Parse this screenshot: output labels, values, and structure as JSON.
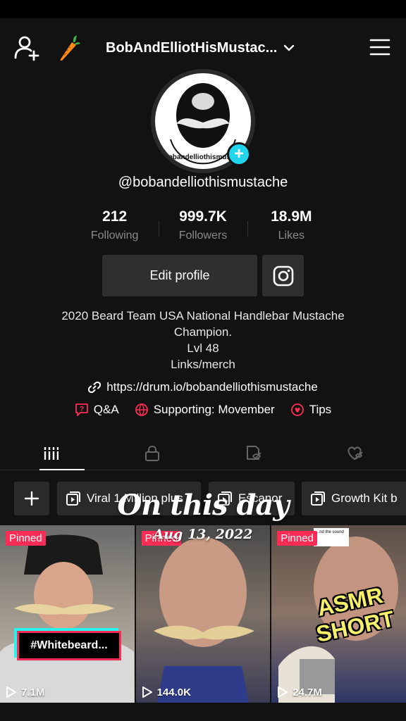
{
  "header": {
    "account_name": "BobAndElliotHisMustac...",
    "add_friend_icon": "user-plus-icon",
    "badge_icon": "carrot-icon",
    "menu_icon": "hamburger-icon"
  },
  "profile": {
    "avatar_text": "@bobandelliothismustache",
    "handle": "@bobandelliothismustache",
    "stats": [
      {
        "value": "212",
        "label": "Following"
      },
      {
        "value": "999.7K",
        "label": "Followers"
      },
      {
        "value": "18.9M",
        "label": "Likes"
      }
    ],
    "edit_label": "Edit profile",
    "bio_lines": [
      "2020 Beard Team USA National Handlebar Mustache",
      "Champion.",
      "Lvl 48",
      "Links/merch"
    ],
    "link": "https://drum.io/bobandelliothismustache",
    "chips": {
      "qa": "Q&A",
      "supporting": "Supporting: Movember",
      "tips": "Tips"
    }
  },
  "playlists": [
    "Viral 1 Million plus",
    "Escanor",
    "Growth Kit b"
  ],
  "overlay": {
    "title": "On this day",
    "date": "Aug 13, 2022"
  },
  "videos": [
    {
      "pinned": "Pinned",
      "views": "7.1M",
      "caption": "#Whitebeard..."
    },
    {
      "pinned": "Pinned",
      "views": "144.0K"
    },
    {
      "pinned": "Pinned",
      "views": "24.7M",
      "caption": "ASMR SHORT",
      "card": "...nd the sound"
    }
  ],
  "colors": {
    "accent_pink": "#ff2d55",
    "accent_cyan": "#20d5ec",
    "background": "#121212"
  }
}
